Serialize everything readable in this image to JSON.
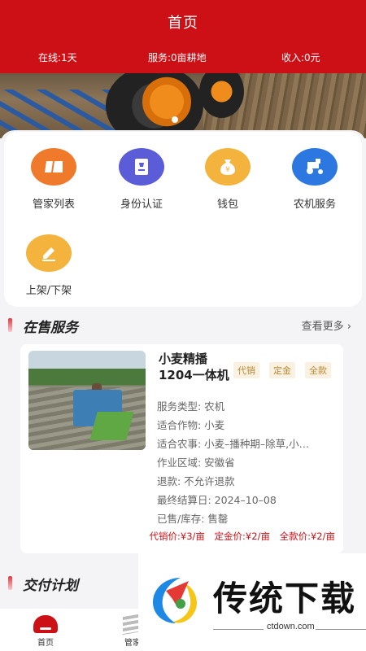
{
  "header": {
    "title": "首页",
    "stats": [
      "在线:1天",
      "服务:0亩耕地",
      "收入:0元"
    ]
  },
  "menu": [
    {
      "label": "管家列表",
      "icon": "card-icon",
      "color": "#f07a2c"
    },
    {
      "label": "身份认证",
      "icon": "id-badge-icon",
      "color": "#5a5cd8"
    },
    {
      "label": "钱包",
      "icon": "money-bag-icon",
      "color": "#f3b33c"
    },
    {
      "label": "农机服务",
      "icon": "tractor-icon",
      "color": "#2d78e0"
    },
    {
      "label": "上架/下架",
      "icon": "edit-icon",
      "color": "#f3b33c"
    }
  ],
  "sections": {
    "on_sale": {
      "title": "在售服务",
      "more": "查看更多"
    },
    "delivery": {
      "title": "交付计划"
    }
  },
  "product": {
    "name": "小麦精播1204一体机",
    "tags": [
      "代销",
      "定金",
      "全款"
    ],
    "lines": [
      "服务类型: 农机",
      "适合作物: 小麦",
      "适合农事: 小麦–播种期–除草,小…",
      "作业区域: 安徽省",
      "退款: 不允许退款",
      "最终结算日: 2024–10–08",
      "已售/库存: 售罄"
    ],
    "prices": [
      "代销价:¥3/亩",
      "定金价:¥2/亩",
      "全款价:¥2/亩"
    ]
  },
  "nav": [
    {
      "label": "首页",
      "icon": "home-icon"
    },
    {
      "label": "管家",
      "icon": "stack-icon"
    }
  ],
  "watermark": {
    "title": "传统下载",
    "url": "ctdown.com"
  }
}
